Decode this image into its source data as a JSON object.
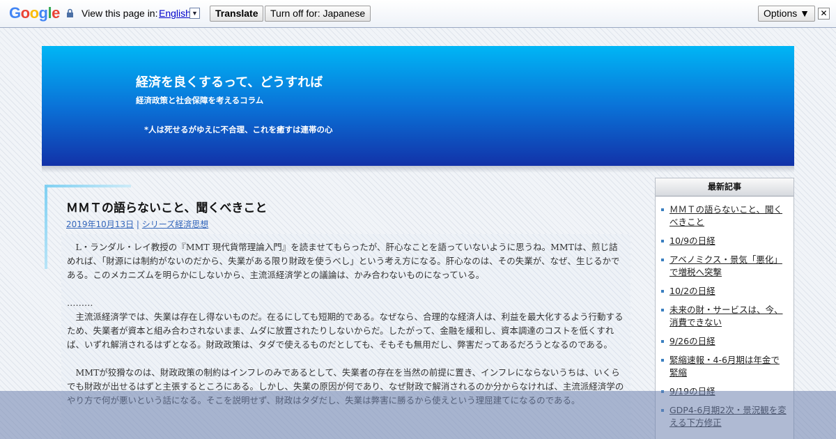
{
  "translate_bar": {
    "logo": "Google",
    "view_label": "View this page in:",
    "language": "English",
    "lang_arrow": "▼",
    "translate_button": "Translate",
    "turn_off_button": "Turn off for: Japanese",
    "options_button": "Options ▼",
    "close": "✕",
    "logo_colors": [
      "#4285f4",
      "#ea4335",
      "#fbbc05",
      "#4285f4",
      "#34a853",
      "#ea4335"
    ]
  },
  "site": {
    "title": "経済を良くするって、どうすれば",
    "subtitle": "経済政策と社会保障を考えるコラム",
    "motto": "*人は死せるがゆえに不合理、これを癒すは連帯の心"
  },
  "post": {
    "title": "ＭＭＴの語らないこと、聞くべきこと",
    "date": "2019年10月13日",
    "separator": "|",
    "category": "シリーズ経済思想",
    "paragraphs": [
      "　L・ランダル・レイ教授の『MMT 現代貨幣理論入門』を読ませてもらったが、肝心なことを語っていないように思うね。MMTは、煎じ詰めれば、「財源には制約がないのだから、失業がある限り財政を使うべし」という考え方になる。肝心なのは、その失業が、なぜ、生じるかである。このメカニズムを明らかにしないから、主流派経済学との議論は、かみ合わないものになっている。",
      "………",
      "　主流派経済学では、失業は存在し得ないものだ。在るにしても短期的である。なぜなら、合理的な経済人は、利益を最大化するよう行動するため、失業者が資本と組み合わされないまま、ムダに放置されたりしないからだ。したがって、金融を緩和し、資本調達のコストを低くすれば、いずれ解消されるはずとなる。財政政策は、タダで使えるものだとしても、そもそも無用だし、弊害だってあるだろうとなるのである。",
      "　MMTが狡猾なのは、財政政策の制約はインフレのみであるとして、失業者の存在を当然の前提に置き、インフレにならないうちは、いくらでも財政が出せるはずと主張するところにある。しかし、失業の原因が何であり、なぜ財政で解消されるのか分からなければ、主流派経済学のやり方で何が悪いという話になる。そこを説明せず、財政はタダだし、失業は弊害に勝るから使えという理屈建てになるのである。"
    ]
  },
  "sidebar": {
    "heading": "最新記事",
    "items": [
      "ＭＭＴの語らないこと、聞くべきこと",
      "10/9の日経",
      "アベノミクス・景気「悪化」で増税へ突撃",
      "10/2の日経",
      "未来の財・サービスは、今、消費できない",
      "9/26の日経",
      "緊縮速報・4-6月期は年金で緊縮",
      "9/19の日経",
      "GDP4-6月期2次・景況観を変える下方修正"
    ]
  }
}
